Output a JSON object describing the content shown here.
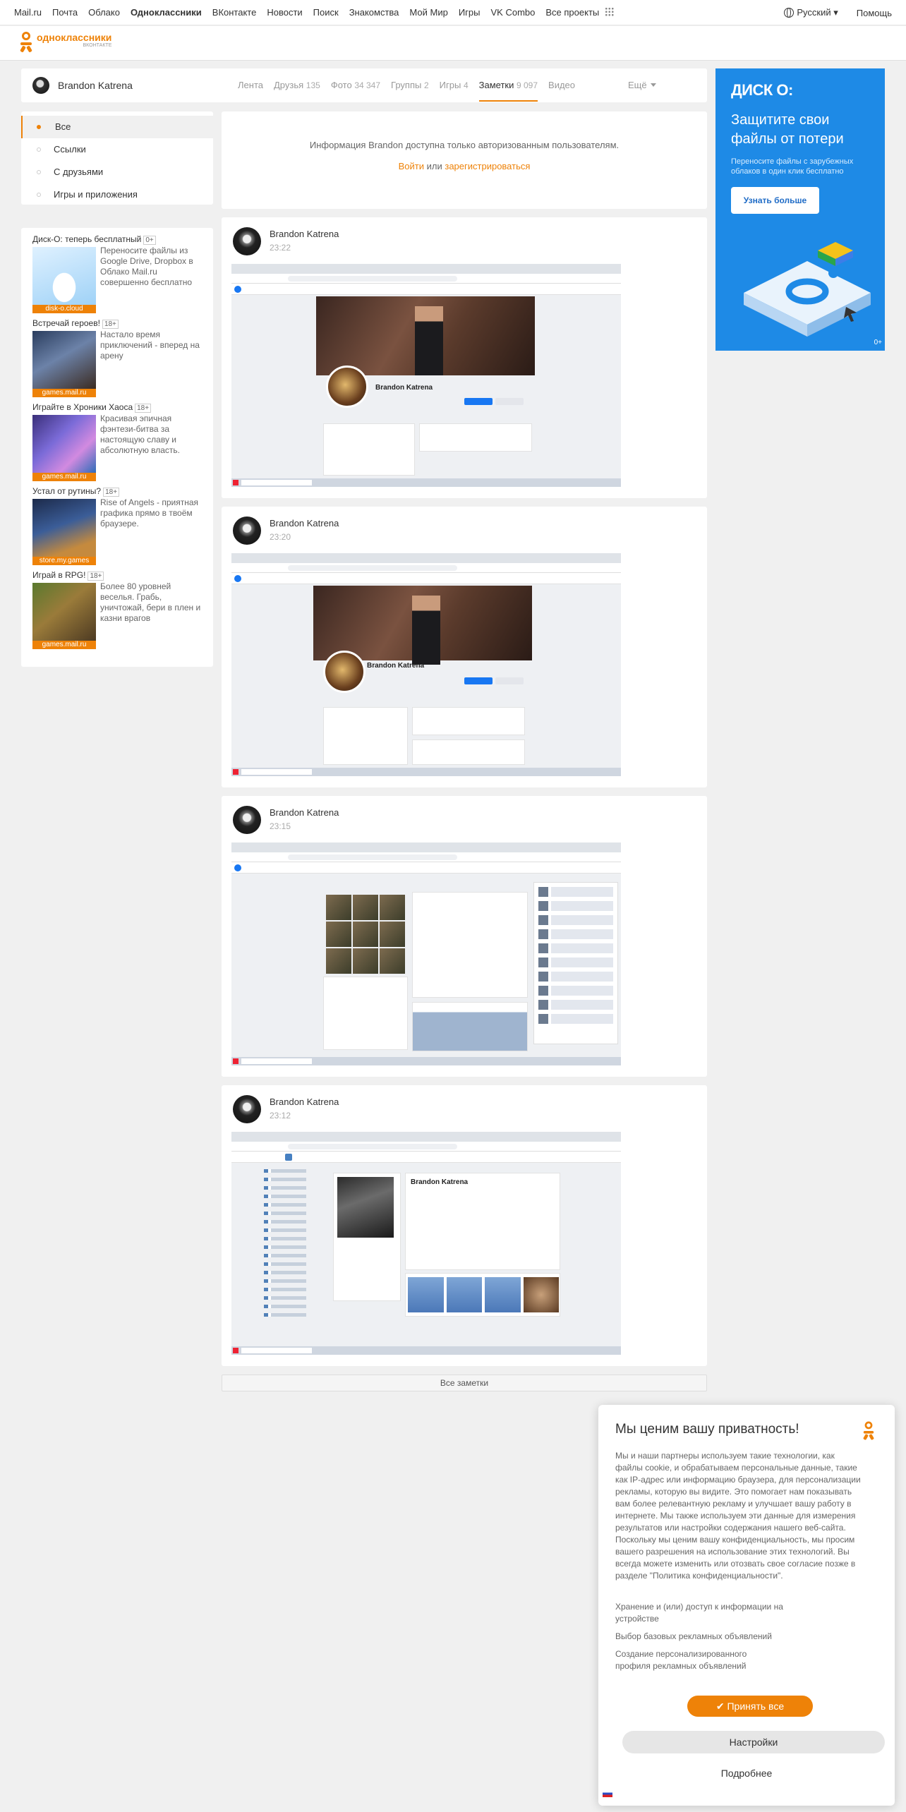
{
  "portal": {
    "links": [
      "Mail.ru",
      "Почта",
      "Облако",
      "Одноклассники",
      "ВКонтакте",
      "Новости",
      "Поиск",
      "Знакомства",
      "Мой Мир",
      "Игры",
      "VK Combo",
      "Все проекты"
    ],
    "language": "Русский",
    "help": "Помощь"
  },
  "logo": {
    "name": "одноклассники",
    "tagline": "ВКОНТАКТЕ"
  },
  "profile": {
    "name": "Brandon Katrena",
    "tabs": [
      {
        "label": "Лента",
        "count": ""
      },
      {
        "label": "Друзья",
        "count": "135"
      },
      {
        "label": "Фото",
        "count": "34 347"
      },
      {
        "label": "Группы",
        "count": "2"
      },
      {
        "label": "Игры",
        "count": "4"
      },
      {
        "label": "Заметки",
        "count": "9 097"
      },
      {
        "label": "Видео",
        "count": ""
      }
    ],
    "more": "Ещё"
  },
  "filters": [
    "Все",
    "Ссылки",
    "С друзьями",
    "Игры и приложения"
  ],
  "ads": [
    {
      "title": "Диск-О: теперь бесплатный",
      "age": "0+",
      "desc": "Переносите файлы из Google Drive, Dropbox в Облако Mail.ru совершенно бесплатно",
      "source": "disk-o.cloud"
    },
    {
      "title": "Встречай героев!",
      "age": "18+",
      "desc": "Настало время приключений - вперед на арену",
      "source": "games.mail.ru"
    },
    {
      "title": "Играйте в Хроники Хаоса",
      "age": "18+",
      "desc": "Красивая эпичная фэнтези-битва за настоящую славу и абсолютную власть.",
      "source": "games.mail.ru"
    },
    {
      "title": "Устал от рутины?",
      "age": "18+",
      "desc": "Rise of Angels - приятная графика прямо в твоём браузере.",
      "source": "store.my.games"
    },
    {
      "title": "Играй в RPG!",
      "age": "18+",
      "desc": "Более 80 уровней веселья. Грабь, уничтожай, бери в плен и казни врагов",
      "source": "games.mail.ru"
    }
  ],
  "info": {
    "message": "Информация Brandon доступна только авторизованным пользователям.",
    "login": "Войти",
    "or": "или",
    "register": "зарегистрироваться"
  },
  "posts": [
    {
      "author": "Brandon Katrena",
      "time": "23:22"
    },
    {
      "author": "Brandon Katrena",
      "time": "23:20"
    },
    {
      "author": "Brandon Katrena",
      "time": "23:15"
    },
    {
      "author": "Brandon Katrena",
      "time": "23:12"
    }
  ],
  "all_notes": "Все заметки",
  "banner": {
    "logo": "ДИСК О:",
    "headline": "Защитите свои файлы от потери",
    "sub": "Переносите файлы с зарубежных облаков в один клик бесплатно",
    "button": "Узнать больше",
    "age": "0+"
  },
  "cookie": {
    "title": "Мы ценим вашу приватность!",
    "text": "Мы и наши партнеры используем такие технологии, как файлы cookie, и обрабатываем персональные данные, такие как IP-адрес или информацию браузера, для персонализации рекламы, которую вы видите. Это помогает нам показывать вам более релевантную рекламу и улучшает вашу работу в интернете. Мы также используем эти данные для измерения результатов или настройки содержания нашего веб-сайта. Поскольку мы ценим вашу конфиденциальность, мы просим вашего разрешения на использование этих технологий. Вы всегда можете изменить или отозвать свое согласие позже в разделе \"Политика конфиденциальности\".",
    "options": [
      "Хранение и (или) доступ к информации на устройстве",
      "Выбор базовых рекламных объявлений",
      "Создание персонализированного профиля рекламных объявлений"
    ],
    "accept": "Принять все",
    "settings": "Настройки",
    "more": "Подробнее"
  },
  "colors": {
    "accent": "#ee8208",
    "banner": "#1e8ae6"
  }
}
